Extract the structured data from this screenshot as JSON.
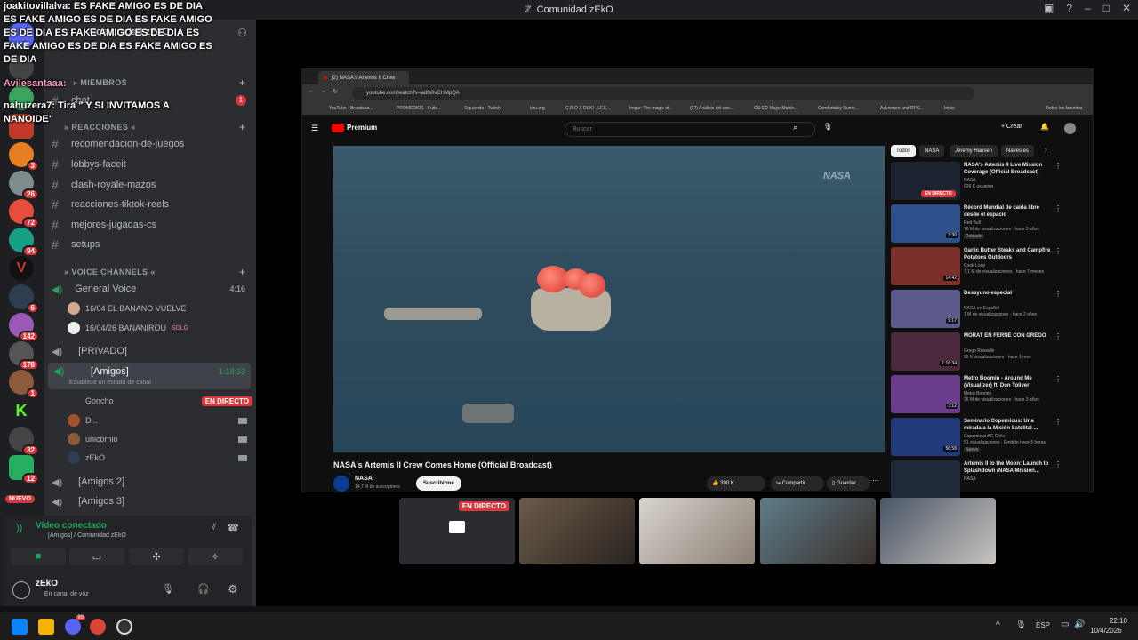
{
  "window": {
    "title": "Comunidad zEkO"
  },
  "chat_overlay": {
    "lines": [
      "joakitovillalva: ES FAKE AMIGO ES DE DIA",
      "ES FAKE AMIGO ES DE DIA  ES FAKE AMIGO ES DE DIA  ES FAKE AMIGO ES DE DIA  ES FAKE AMIGO ES DE DIA  ES FAKE AMIGO ES DE DIA",
      "Avilesantaaa:",
      "nahuzera7: Tira \" Y SI INVITAMOS A NANOIDE\""
    ]
  },
  "server": {
    "name": "Comunidad zEkO"
  },
  "rail_badges": [
    "3",
    "26",
    "72",
    "94",
    "6",
    "142",
    "178",
    "1",
    "32",
    "12"
  ],
  "rail_new": "NUEVO",
  "sidebar": {
    "categories": {
      "miembros": "MIEMBROS",
      "reacciones": "REACCIONES",
      "voice": "VOICE CHANNELS"
    },
    "chat_channel": "chat",
    "chat_badge": "1",
    "text_channels": [
      "recomendacion-de-juegos",
      "lobbys-faceit",
      "clash-royale-mazos",
      "reacciones-tiktok-reels",
      "mejores-jugadas-cs",
      "setups"
    ],
    "general_voice": {
      "name": "General Voice",
      "time": "4:16"
    },
    "general_users": [
      {
        "name": "16/04 EL BANANO VUELVE"
      },
      {
        "name": "16/04/26 BANANIROU",
        "tag": "SDLG"
      }
    ],
    "privado": "[PRIVADO]",
    "amigos": {
      "name": "[Amigos]",
      "time": "1:18:33",
      "status": "Establece un estado de canal"
    },
    "amigos_users": [
      {
        "name": "Goncho",
        "live": "EN DIRECTO"
      },
      {
        "name": "D..."
      },
      {
        "name": "unicornio"
      },
      {
        "name": "zEkO"
      }
    ],
    "amigos2": "[Amigos 2]",
    "amigos3": "[Amigos 3]"
  },
  "voice_panel": {
    "status": "Video conectado",
    "location": "[Amigos] / Comunidad zEkO"
  },
  "user": {
    "name": "zEkO",
    "status": "En canal de voz"
  },
  "browser": {
    "tab_title": "(2) NASA's Artemis II Crew",
    "url": "youtube.com/watch?v=adfs0vCHMpQA",
    "bookmarks": [
      "YouTube - Broadcas...",
      "PROMEDIOS - Futb...",
      "Siguiendo - Twitch",
      "kiru.org",
      "C.R.O X DUKI - LEX...",
      "Imgur: The magic of...",
      "(57) Análisis del can...",
      "CS:GO Major Match...",
      "Comfortably Numb...",
      "Adventure and RPG...",
      "Inicio",
      "Todos los favoritos"
    ],
    "yt_logo": "Premium",
    "search_placeholder": "Buscar",
    "create": "Crear",
    "chips": [
      "Todos",
      "NASA",
      "Jeremy Hansen",
      "Naves es"
    ],
    "watermark": "NASA",
    "video_title": "NASA's Artemis II Crew Comes Home (Official Broadcast)",
    "channel": "NASA",
    "subs": "14,7 M de suscriptores",
    "subscribe": "Suscribirme",
    "likes": "390 K",
    "share": "Compartir",
    "save": "Guardar",
    "recommendations": [
      {
        "title": "NASA's Artemis II Live Mission Coverage (Official Broadcast)",
        "channel": "NASA",
        "meta": "926 K usuarios",
        "badge": "EN DIRECTO",
        "color": "#1b2430"
      },
      {
        "title": "Récord Mundial de caída libre desde el espacio",
        "channel": "Red Bull",
        "meta": "70 M de visualizaciones · hace 3 años",
        "extra": "Doblado",
        "dur": "3:30",
        "color": "#2d4f8a"
      },
      {
        "title": "Garlic Butter Steaks and Campfire Potatoes Outdoors",
        "channel": "Cook Loop",
        "meta": "7,1 M de visualizaciones · hace 7 meses",
        "dur": "14:42",
        "color": "#7a2f2a"
      },
      {
        "title": "Desayuno especial",
        "channel": "NASA en Español",
        "meta": "1 M de visualizaciones · hace 2 años",
        "dur": "9:17",
        "color": "#5d5b8c"
      },
      {
        "title": "MORAT EN FERNÉ CON GREGO",
        "channel": "Grego Rossello",
        "meta": "55 K visualizaciones · hace 1 mes",
        "dur": "1:16:34",
        "color": "#4a2a3c"
      },
      {
        "title": "Metro Boomin - Around Me (Visualizer) ft. Don Toliver",
        "channel": "Metro Boomin",
        "meta": "36 M de visualizaciones · hace 3 años",
        "dur": "3:12",
        "color": "#6b3e8c"
      },
      {
        "title": "Seminario Copernicus: Una mirada a la Misión Satelital ...",
        "channel": "Copernicus AC Chile",
        "meta": "51 visualizaciones · Emitido hace 5 horas",
        "extra": "Nuevo",
        "dur": "56:58",
        "color": "#223a7a"
      },
      {
        "title": "Artemis II to the Moon: Launch to Splashdown (NASA Mission...",
        "channel": "NASA",
        "meta": "",
        "color": "#1e2a3a"
      }
    ]
  },
  "stream_tiles": [
    {
      "live": "EN DIRECTO"
    }
  ],
  "taskbar": {
    "discord_badge": "99",
    "lang": "ESP",
    "time": "22:10",
    "date": "10/4/2026"
  },
  "colors": {
    "discord_bg": "#2b2d31",
    "accent_green": "#23a55a",
    "live_red": "#da373c",
    "yt_bg": "#0f0f0f"
  }
}
